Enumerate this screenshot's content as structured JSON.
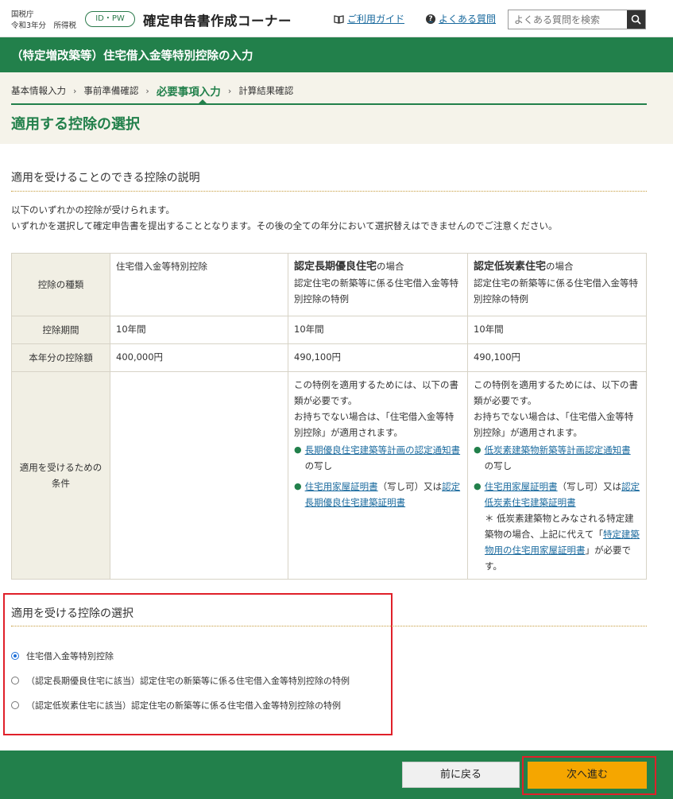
{
  "header": {
    "agency": "国税庁",
    "year_tax": "令和3年分　所得税",
    "id_pill": "ID・PW",
    "app_title": "確定申告書作成コーナー",
    "guide_link": "ご利用ガイド",
    "faq_link": "よくある質問",
    "search_placeholder": "よくある質問を検索"
  },
  "title_bar": "（特定増改築等）住宅借入金等特別控除の入力",
  "steps": [
    "基本情報入力",
    "事前準備確認",
    "必要事項入力",
    "計算結果確認"
  ],
  "page_title": "適用する控除の選択",
  "explanation": {
    "heading": "適用を受けることのできる控除の説明",
    "line1": "以下のいずれかの控除が受けられます。",
    "line2": "いずれかを選択して確定申告書を提出することとなります。その後の全ての年分において選択替えはできませんのでご注意ください。"
  },
  "table": {
    "labels": {
      "type": "控除の種類",
      "period": "控除期間",
      "amount": "本年分の控除額",
      "cond_1": "適用を受けるための",
      "cond_2": "条件"
    },
    "col1": {
      "type": "住宅借入金等特別控除",
      "period": "10年間",
      "amount": "400,000円"
    },
    "col2": {
      "bold": "認定長期優良住宅",
      "suffix": "の場合",
      "desc": "認定住宅の新築等に係る住宅借入金等特別控除の特例",
      "period": "10年間",
      "amount": "490,100円",
      "cond_intro": "この特例を適用するためには、以下の書類が必要です。",
      "cond_missing": "お持ちでない場合は、「住宅借入金等特別控除」が適用されます。",
      "doc1": "長期優良住宅建築等計画の認定通知書",
      "doc1_suffix": "の写し",
      "doc2a": "住宅用家屋証明書",
      "doc2_mid": "（写し可）又は",
      "doc2b": "認定長期優良住宅建築証明書"
    },
    "col3": {
      "bold": "認定低炭素住宅",
      "suffix": "の場合",
      "desc": "認定住宅の新築等に係る住宅借入金等特別控除の特例",
      "period": "10年間",
      "amount": "490,100円",
      "cond_intro": "この特例を適用するためには、以下の書類が必要です。",
      "cond_missing": "お持ちでない場合は、「住宅借入金等特別控除」が適用されます。",
      "doc1": "低炭素建築物新築等計画認定通知書",
      "doc1_suffix": "の写し",
      "doc2a": "住宅用家屋証明書",
      "doc2_mid": "（写し可）又は",
      "doc2b": "認定低炭素住宅建築証明書",
      "note_pre": "＊ 低炭素建築物とみなされる特定建築物の場合、上記に代えて「",
      "note_link": "特定建築物用の住宅用家屋証明書",
      "note_post": "」が必要です。"
    }
  },
  "selection": {
    "heading": "適用を受ける控除の選択",
    "options": [
      "住宅借入金等特別控除",
      "（認定長期優良住宅に該当）認定住宅の新築等に係る住宅借入金等特別控除の特例",
      "（認定低炭素住宅に該当）認定住宅の新築等に係る住宅借入金等特別控除の特例"
    ],
    "selected_index": 0
  },
  "footer": {
    "back": "前に戻る",
    "next": "次へ進む"
  },
  "colors": {
    "brand_green": "#22804b",
    "next_button": "#f5a600",
    "highlight_red": "#e0202a",
    "link_blue": "#1a6a9e"
  }
}
